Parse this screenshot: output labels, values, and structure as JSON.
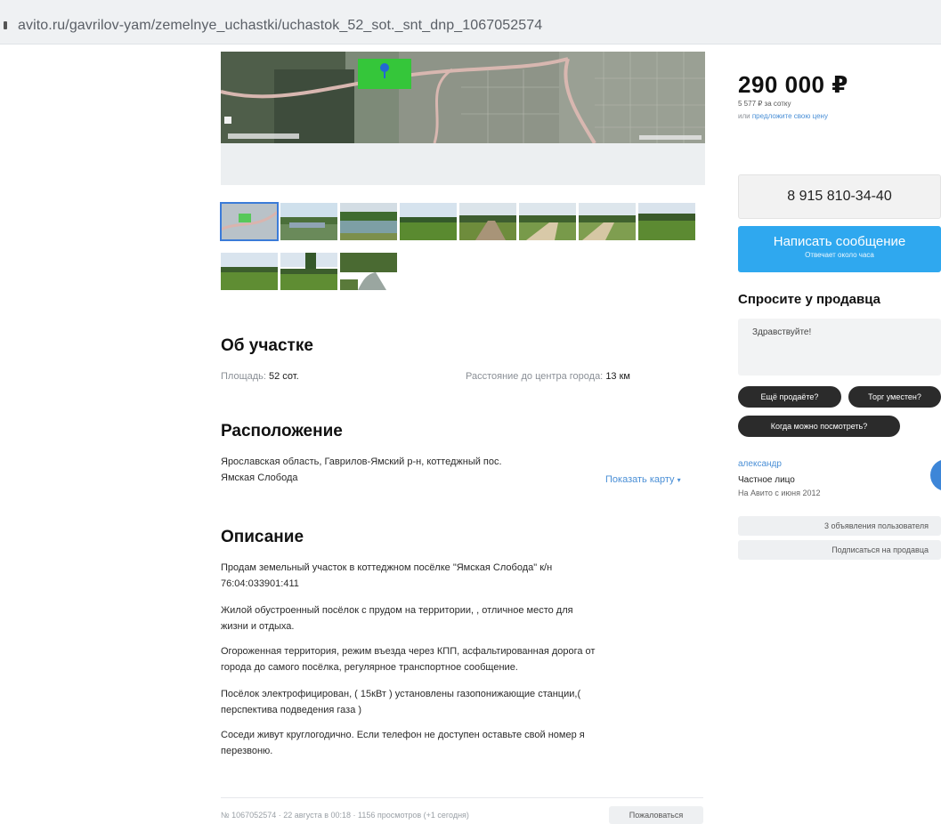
{
  "browser": {
    "url": "avito.ru/gavrilov-yam/zemelnye_uchastki/uchastok_52_sot._snt_dnp_1067052574"
  },
  "gallery": {
    "thumbnails": [
      {
        "kind": "map"
      },
      {
        "kind": "field-water"
      },
      {
        "kind": "pond"
      },
      {
        "kind": "field"
      },
      {
        "kind": "dirt-road"
      },
      {
        "kind": "gravel-road"
      },
      {
        "kind": "gravel-road"
      },
      {
        "kind": "field"
      },
      {
        "kind": "field"
      },
      {
        "kind": "trees-field"
      },
      {
        "kind": "stream"
      }
    ]
  },
  "about": {
    "title": "Об участке",
    "area_label": "Площадь:",
    "area_value": "52 сот.",
    "distance_label": "Расстояние до центра города:",
    "distance_value": "13 км"
  },
  "location": {
    "title": "Расположение",
    "address_line1": "Ярославская область, Гаврилов-Ямский р-н, коттеджный пос.",
    "address_line2": "Ямская Слобода",
    "show_map": "Показать карту"
  },
  "description": {
    "title": "Описание",
    "paragraphs": [
      [
        "Продам земельный участок в коттеджном посёлке \"Ямская Слобода\" к/н",
        "76:04:033901:411"
      ],
      [
        "Жилой обустроенный посёлок с прудом на территории, , отличное место для",
        "жизни и отдыха."
      ],
      [
        "Огороженная территория, режим въезда через КПП, асфальтированная дорога от",
        "города до самого посёлка, регулярное транспортное сообщение."
      ],
      [
        "Посёлок электрофицирован, ( 15кВт ) установлены газопонижающие станции,(",
        "перспектива подведения газа )"
      ],
      [
        "Соседи живут круглогодично.   Если телефон не доступен оставьте свой номер я",
        "перезвоню."
      ]
    ]
  },
  "footer": {
    "meta": "№ 1067052574 · 22 августа в 00:18 · 1156 просмотров (+1 сегодня)",
    "report": "Пожаловаться"
  },
  "sidebar": {
    "price": "290 000 ₽",
    "per_sotka": "5 577 ₽ за сотку",
    "offer_prefix": "или",
    "offer_link": "предложите свою цену",
    "phone": "8 915 810-34-40",
    "message_button": "Написать сообщение",
    "message_sub": "Отвечает около часа",
    "ask_title": "Спросите у продавца",
    "ask_placeholder": "Здравствуйте!",
    "chips": [
      "Ещё продаёте?",
      "Торг уместен?",
      "Когда можно посмотреть?"
    ],
    "seller_name": "александр",
    "seller_type": "Частное лицо",
    "seller_since": "На Авито с июня 2012",
    "listings_button": "3 объявления пользователя",
    "subscribe_button": "Подписаться на продавца"
  },
  "colors": {
    "accent": "#2fa8ef",
    "link": "#4a8fd6"
  }
}
